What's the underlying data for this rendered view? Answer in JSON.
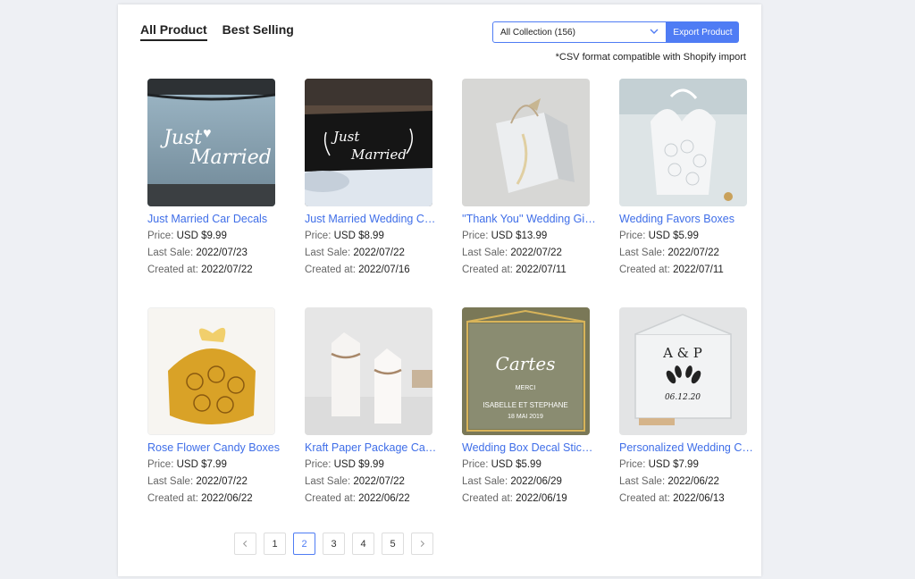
{
  "tabs": [
    {
      "label": "All Product",
      "active": true
    },
    {
      "label": "Best Selling",
      "active": false
    }
  ],
  "collection_select": {
    "value": "All Collection (156)"
  },
  "export_button": {
    "label": "Export Product"
  },
  "csv_note": "*CSV format compatible with Shopify import",
  "labels": {
    "price": "Price: ",
    "last_sale": "Last Sale: ",
    "created_at": "Created at: "
  },
  "products": [
    {
      "title": "Just Married Car Decals",
      "price": "USD $9.99",
      "last_sale": "2022/07/23",
      "created_at": "2022/07/22"
    },
    {
      "title": "Just Married Wedding Car Sign",
      "price": "USD $8.99",
      "last_sale": "2022/07/22",
      "created_at": "2022/07/16"
    },
    {
      "title": "''Thank You'' Wedding Gift Bags",
      "price": "USD $13.99",
      "last_sale": "2022/07/22",
      "created_at": "2022/07/11"
    },
    {
      "title": "Wedding Favors Boxes",
      "price": "USD $5.99",
      "last_sale": "2022/07/22",
      "created_at": "2022/07/11"
    },
    {
      "title": "Rose Flower Candy Boxes",
      "price": "USD $7.99",
      "last_sale": "2022/07/22",
      "created_at": "2022/06/22"
    },
    {
      "title": "Kraft Paper Package Candy Box",
      "price": "USD $9.99",
      "last_sale": "2022/07/22",
      "created_at": "2022/06/22"
    },
    {
      "title": "Wedding Box Decal Sticker",
      "price": "USD $5.99",
      "last_sale": "2022/06/29",
      "created_at": "2022/06/19"
    },
    {
      "title": "Personalized Wedding Card Box",
      "price": "USD $7.99",
      "last_sale": "2022/06/22",
      "created_at": "2022/06/13"
    }
  ],
  "image_texts": {
    "p1": [
      "Just",
      "Married"
    ],
    "p2": [
      "Just",
      "Married"
    ],
    "p7": [
      "Cartes",
      "MERCI",
      "ISABELLE ET STEPHANE",
      "18 MAI 2019"
    ],
    "p8": [
      "A & P",
      "06.12.20"
    ]
  },
  "pagination": {
    "pages": [
      "1",
      "2",
      "3",
      "4",
      "5"
    ],
    "current": "2",
    "icons": {
      "prev": "chevron-left-icon",
      "next": "chevron-right-icon"
    }
  },
  "colors": {
    "accent": "#4f7cf4",
    "link": "#3f6ee8"
  }
}
